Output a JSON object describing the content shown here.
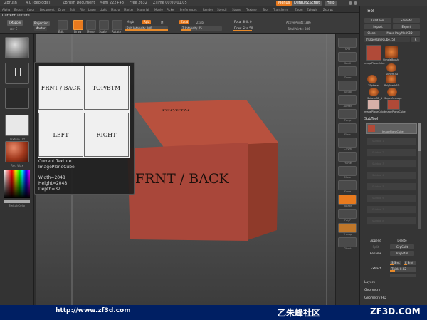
{
  "app": {
    "title_items": [
      "ZBrush",
      "4.0 [geologic]",
      "ZBrush Document",
      "Mem 222+48",
      "Free 2632",
      "ZTime 00:00:01.05"
    ],
    "menus_btn": "Menus",
    "default_script": "DefaultZScript",
    "help": "Help"
  },
  "menubar": [
    "Alpha",
    "Brush",
    "Color",
    "Document",
    "Draw",
    "Edit",
    "File",
    "Layer",
    "Light",
    "Macro",
    "Marker",
    "Material",
    "Movie",
    "Picker",
    "Preferences",
    "Render",
    "Stencil",
    "Stroke",
    "Texture",
    "Tool",
    "Transform",
    "Zoom",
    "Zplugin",
    "Zscript"
  ],
  "current_texture_label": "Current Texture",
  "toptools": {
    "zmapper": "ZMapper",
    "zmapper_sub": "rev-E",
    "projection": "Projection",
    "projection_sub": "Master",
    "buttons": [
      "Edit",
      "Draw",
      "Move",
      "Scale",
      "Rotate"
    ],
    "mrgb": "Mrgb",
    "rgb": "Rgb",
    "m": "M",
    "rgb_intensity_label": "Rgb Intensity",
    "rgb_intensity": "100",
    "zadd": "Zadd",
    "zsub": "Zsub",
    "z_intensity_label": "Z Intensity",
    "z_intensity": "25",
    "focal_shift_label": "Focal Shift",
    "focal_shift": "0",
    "draw_size_label": "Draw Size",
    "draw_size": "50",
    "active_points_label": "ActivePoints:",
    "active_points": "386",
    "total_points_label": "TotalPoints:",
    "total_points": "386"
  },
  "leftshelf": {
    "captions": [
      "",
      "",
      "",
      "Texture Off",
      "Red Wax",
      "",
      "SwitchColor"
    ]
  },
  "popup": {
    "tiles": [
      "FRNT / BACK",
      "TOP/BTM",
      "LEFT",
      "RIGHT"
    ],
    "label": "Current Texture",
    "name": "ImagePlaneCube",
    "width": "Width=2048",
    "height": "Height=2048",
    "depth": "Depth=32"
  },
  "cube": {
    "front": "FRNT / BACK",
    "top": "TOP/BTM"
  },
  "rightshelf": [
    "SPix",
    "Scroll",
    "Zoom",
    "Actual",
    "AAHalf",
    "Persp",
    "Floor",
    "L.Sym",
    "Frame",
    "Move",
    "Scale",
    "Rotate",
    "PolyF",
    "Transp",
    "Ghost",
    "Solo",
    "Xpose"
  ],
  "rpanel": {
    "title": "Tool",
    "load_tool": "Load Tool",
    "save_as": "Save As",
    "import": "Import",
    "export": "Export",
    "clone": "Clone",
    "make_polymesh": "Make PolyMesh3D",
    "current_tool": "ImagePlaneCube. 52",
    "r": "R",
    "tool_grid": [
      "SimpleBrush",
      "ImagePlaneCube",
      "Sphere3D",
      "ZSphere",
      "PolyMesh3D",
      "Sphere3D_1",
      "SuperAverage",
      "ImagePlaneCube",
      "ImagePlaneCube"
    ],
    "subtool": "SubTool",
    "subtool_active": "ImagePlaneCube",
    "subtool_rows": [
      "Subtool 1",
      "Subtool 2",
      "Subtool 3",
      "Subtool 4",
      "Subtool 5",
      "Subtool 6",
      "Subtool 7",
      "Subtool 8"
    ],
    "append": "Append",
    "delete": "Delete",
    "split": "Split",
    "groupsplit": "GrpSplit",
    "rename": "Rename",
    "projectall": "ProjectAll",
    "extract": "Extract",
    "s_smt": "S Smt",
    "e_smt": "E Smt",
    "thick": "Thick 0.02",
    "layers": "Layers",
    "geometry": "Geometry",
    "geometry_hd": "Geometry HD"
  },
  "footer": {
    "url": "http://www.zf3d.com",
    "brand": "乙朱峰社区",
    "site": "ZF3D.COM"
  },
  "colors": {
    "accent": "#e87a1e",
    "cube": "#b04a38",
    "footer": "#001f63"
  }
}
